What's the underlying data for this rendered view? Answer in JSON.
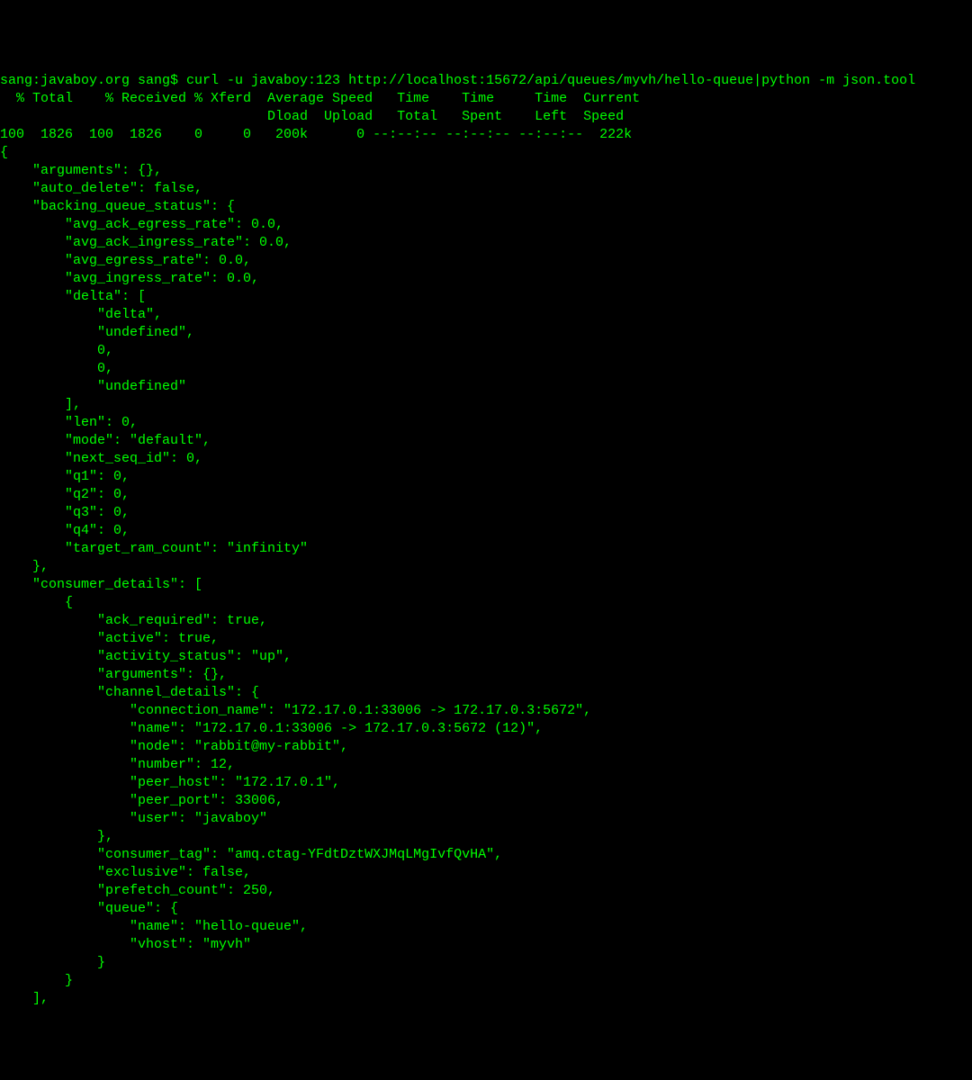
{
  "terminal": {
    "prompt_line": "sang:javaboy.org sang$ curl -u javaboy:123 http://localhost:15672/api/queues/myvh/hello-queue|python -m json.tool",
    "curl_header1": "  % Total    % Received % Xferd  Average Speed   Time    Time     Time  Current",
    "curl_header2": "                                 Dload  Upload   Total   Spent    Left  Speed",
    "curl_stats": "100  1826  100  1826    0     0   200k      0 --:--:-- --:--:-- --:--:--  222k",
    "json_lines": [
      "{",
      "    \"arguments\": {},",
      "    \"auto_delete\": false,",
      "    \"backing_queue_status\": {",
      "        \"avg_ack_egress_rate\": 0.0,",
      "        \"avg_ack_ingress_rate\": 0.0,",
      "        \"avg_egress_rate\": 0.0,",
      "        \"avg_ingress_rate\": 0.0,",
      "        \"delta\": [",
      "            \"delta\",",
      "            \"undefined\",",
      "            0,",
      "            0,",
      "            \"undefined\"",
      "        ],",
      "        \"len\": 0,",
      "        \"mode\": \"default\",",
      "        \"next_seq_id\": 0,",
      "        \"q1\": 0,",
      "        \"q2\": 0,",
      "        \"q3\": 0,",
      "        \"q4\": 0,",
      "        \"target_ram_count\": \"infinity\"",
      "    },",
      "    \"consumer_details\": [",
      "        {",
      "            \"ack_required\": true,",
      "            \"active\": true,",
      "            \"activity_status\": \"up\",",
      "            \"arguments\": {},",
      "            \"channel_details\": {",
      "                \"connection_name\": \"172.17.0.1:33006 -> 172.17.0.3:5672\",",
      "                \"name\": \"172.17.0.1:33006 -> 172.17.0.3:5672 (12)\",",
      "                \"node\": \"rabbit@my-rabbit\",",
      "                \"number\": 12,",
      "                \"peer_host\": \"172.17.0.1\",",
      "                \"peer_port\": 33006,",
      "                \"user\": \"javaboy\"",
      "            },",
      "            \"consumer_tag\": \"amq.ctag-YFdtDztWXJMqLMgIvfQvHA\",",
      "            \"exclusive\": false,",
      "            \"prefetch_count\": 250,",
      "            \"queue\": {",
      "                \"name\": \"hello-queue\",",
      "                \"vhost\": \"myvh\"",
      "            }",
      "        }",
      "    ],"
    ]
  }
}
